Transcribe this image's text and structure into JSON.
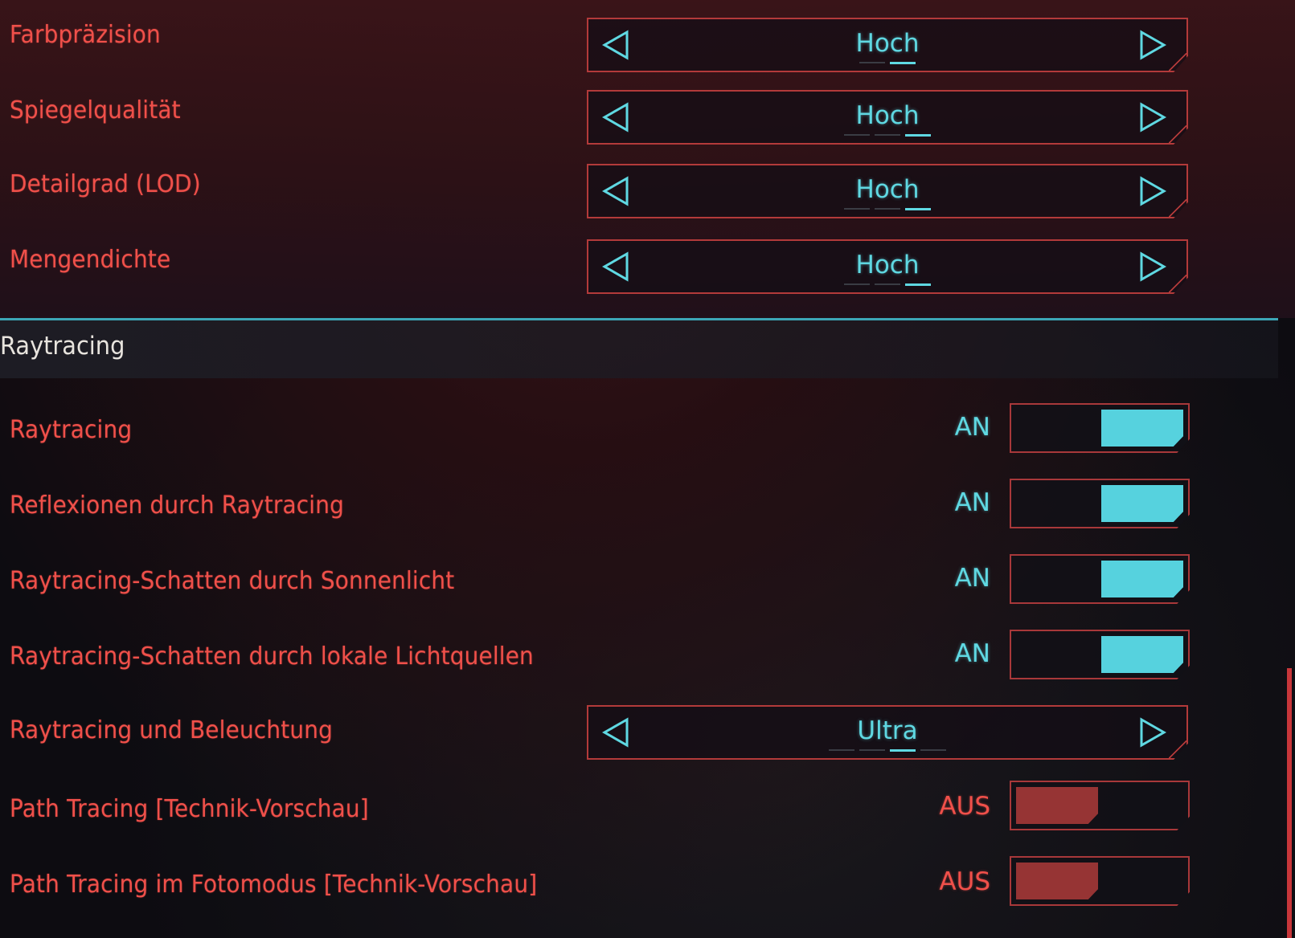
{
  "graphics": {
    "selectors_top": [
      {
        "label": "Farbpräzision",
        "value": "Hoch"
      },
      {
        "label": "Spiegelqualität",
        "value": "Hoch"
      },
      {
        "label": "Detailgrad (LOD)",
        "value": "Hoch"
      },
      {
        "label": "Mengendichte",
        "value": "Hoch"
      }
    ]
  },
  "raytracing": {
    "section_title": "Raytracing",
    "toggles_on": [
      {
        "label": "Raytracing",
        "state": "AN"
      },
      {
        "label": "Reflexionen durch Raytracing",
        "state": "AN"
      },
      {
        "label": "Raytracing-Schatten durch Sonnenlicht",
        "state": "AN"
      },
      {
        "label": "Raytracing-Schatten durch lokale Lichtquellen",
        "state": "AN"
      }
    ],
    "lighting": {
      "label": "Raytracing und Beleuchtung",
      "value": "Ultra"
    },
    "toggles_off": [
      {
        "label": "Path Tracing [Technik-Vorschau]",
        "state": "AUS"
      },
      {
        "label": "Path Tracing im Fotomodus [Technik-Vorschau]",
        "state": "AUS"
      }
    ]
  },
  "icons": {
    "prev": "triangle-left-icon",
    "next": "triangle-right-icon"
  },
  "colors": {
    "label_red": "#f0504a",
    "accent_cyan": "#5fd8e2",
    "border_red": "#b33a3a",
    "toggle_on": "#56d2de",
    "toggle_off": "#963434"
  }
}
